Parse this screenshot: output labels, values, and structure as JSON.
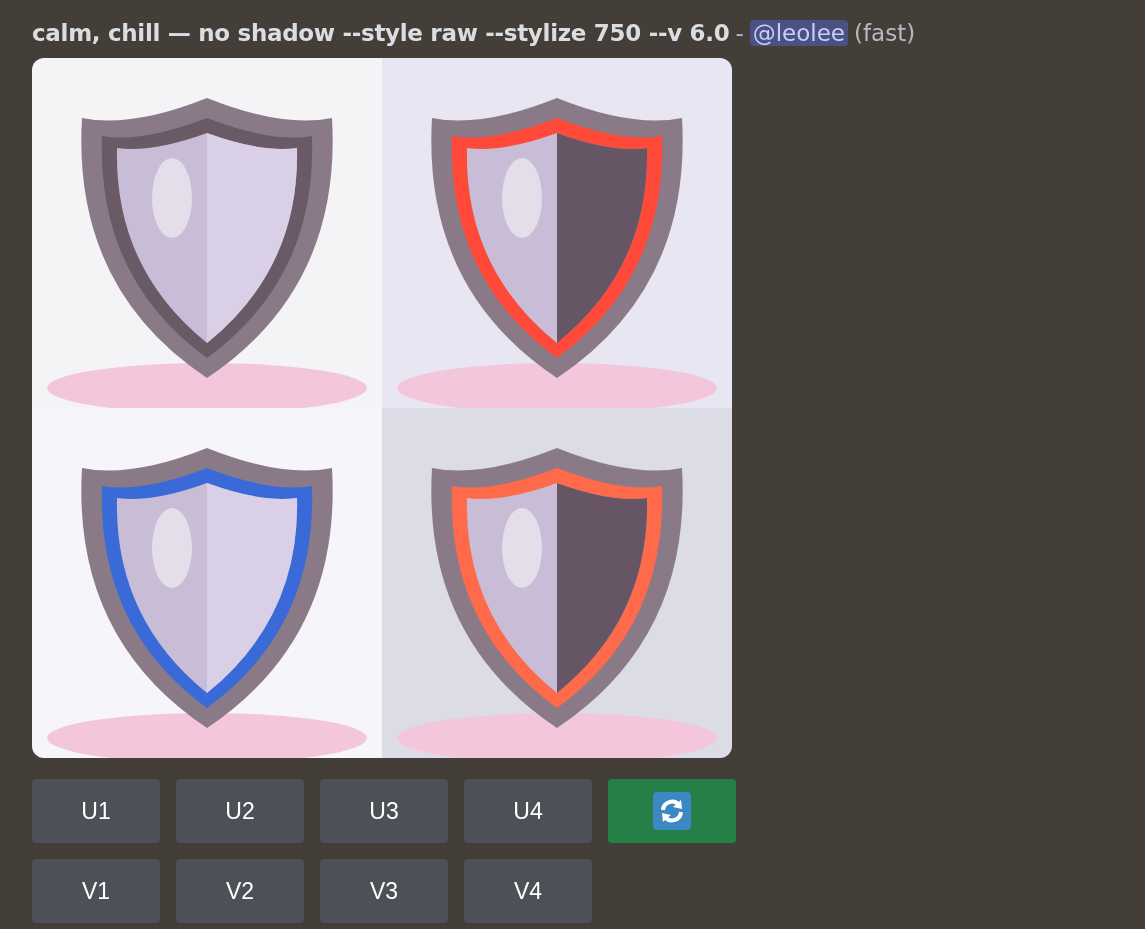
{
  "message": {
    "prompt": "calm, chill — no shadow --style raw --stylize 750 --v 6.0",
    "separator": "-",
    "mention": "@leolee",
    "mode": "(fast)"
  },
  "image_grid": [
    {
      "kind": "picture"
    },
    {
      "kind": "picture"
    },
    {
      "kind": "picture"
    },
    {
      "kind": "picture"
    }
  ],
  "button_rows": [
    [
      {
        "kind": "label",
        "label": "U1"
      },
      {
        "kind": "label",
        "label": "U2"
      },
      {
        "kind": "label",
        "label": "U3"
      },
      {
        "kind": "label",
        "label": "U4"
      },
      {
        "kind": "reroll"
      }
    ],
    [
      {
        "kind": "label",
        "label": "V1"
      },
      {
        "kind": "label",
        "label": "V2"
      },
      {
        "kind": "label",
        "label": "V3"
      },
      {
        "kind": "label",
        "label": "V4"
      }
    ]
  ]
}
